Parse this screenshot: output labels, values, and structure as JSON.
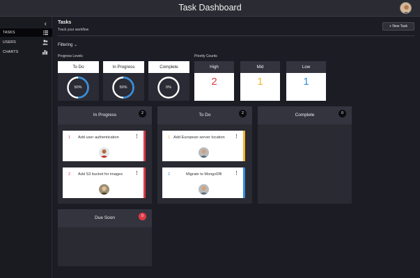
{
  "app": {
    "title": "Task Dashboard"
  },
  "sidebar": {
    "collapse_glyph": "‹",
    "items": [
      {
        "label": "TASKS",
        "icon": "list-icon",
        "active": true
      },
      {
        "label": "USERS",
        "icon": "users-icon",
        "active": false
      },
      {
        "label": "CHARTS",
        "icon": "bar-chart-icon",
        "active": false
      }
    ]
  },
  "header": {
    "title": "Tasks",
    "subtitle": "Track your workflow",
    "new_task_label": "+ New Task"
  },
  "filtering": {
    "label": "Filtering",
    "chevron": "⌄"
  },
  "progress_levels": {
    "label": "Progress Levels",
    "items": [
      {
        "name": "To Do",
        "value": "50%",
        "fraction": 0.5
      },
      {
        "name": "In Progress",
        "value": "50%",
        "fraction": 0.5
      },
      {
        "name": "Complete",
        "value": "0%",
        "fraction": 0
      }
    ]
  },
  "priority_counts": {
    "label": "Priority Counts",
    "items": [
      {
        "name": "High",
        "value": "2",
        "color": "#e03a46"
      },
      {
        "name": "Mid",
        "value": "1",
        "color": "#f2b62b"
      },
      {
        "name": "Low",
        "value": "1",
        "color": "#2f8ee0"
      }
    ]
  },
  "columns": [
    {
      "title": "In Progress",
      "count": "2",
      "tasks": [
        {
          "priority": "1",
          "text": "Add user authentication",
          "color": "#e03a46"
        },
        {
          "priority": "2",
          "text": "Add S3 bucket for images",
          "color": "#e03a46"
        }
      ]
    },
    {
      "title": "To Do",
      "count": "2",
      "tasks": [
        {
          "priority": "1",
          "text": "Add European server location",
          "color": "#f2b62b"
        },
        {
          "priority": "2",
          "text": "Migrate to MongoDB",
          "color": "#2f8ee0"
        }
      ]
    },
    {
      "title": "Complete",
      "count": "0",
      "tasks": []
    },
    {
      "title": "Due Soon",
      "count": "0",
      "tasks": []
    }
  ],
  "task_menu_glyph": "⋮",
  "colors": {
    "accent_ring": "#2f8ee0",
    "ring_track": "#ffffff",
    "badge_alert": "#e03a46"
  }
}
